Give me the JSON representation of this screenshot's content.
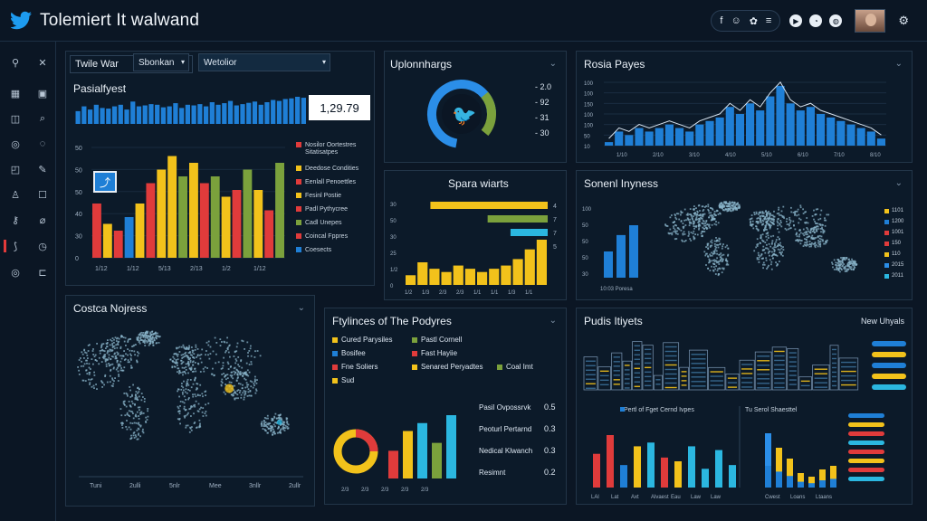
{
  "app": {
    "title": "Tolemiert   It walwand"
  },
  "header": {
    "social_icons": [
      "f",
      "☺",
      "✿",
      "≡"
    ],
    "action_icons": [
      "▶",
      "◔",
      "◍"
    ],
    "settings_icon": "⚙"
  },
  "sidebar": {
    "icons": [
      [
        "⚲",
        "✕"
      ],
      [
        "▦",
        "▣"
      ],
      [
        "◫",
        "⌕"
      ],
      [
        "◎",
        "◌"
      ],
      [
        "◰",
        "✎"
      ],
      [
        "♙",
        "☐"
      ],
      [
        "⚷",
        "⌀"
      ],
      [
        "⟆",
        "◷"
      ],
      [
        "◎",
        "⊏"
      ]
    ]
  },
  "panel1": {
    "tab_label": "Twile War",
    "select1": "Sbonkan",
    "select2": "Wetolior",
    "subtitle": "Pasialfyest",
    "big_number": "1,29.79",
    "chart_data": {
      "type": "bar",
      "x_ticks": [
        "1/12",
        "1/12",
        "5/13",
        "2/13",
        "1/2",
        "1/12"
      ],
      "y_ticks": [
        "50",
        "50",
        "50",
        "40",
        "30",
        "0"
      ],
      "legend": [
        "Nosilor Oortestres Sitatisatpes",
        "Deedose Condities",
        "Eenlall Penoettles",
        "Fesinl Postie",
        "Padl Pythycree",
        "Cadl Unepes",
        "Coincal Fppres",
        "Coesects"
      ],
      "values": [
        40,
        25,
        20,
        30,
        40,
        55,
        65,
        75,
        60,
        70,
        55,
        60,
        45,
        50,
        65,
        50,
        35,
        70
      ],
      "colors": [
        "#e03b3b",
        "#f2c21b",
        "#e03b3b",
        "#1f7fd6",
        "#f2c21b",
        "#e03b3b",
        "#f2c21b",
        "#f2c21b",
        "#7ba13c",
        "#f2c21b",
        "#e03b3b",
        "#7ba13c",
        "#f2c21b",
        "#e03b3b",
        "#7ba13c",
        "#f2c21b",
        "#e03b3b",
        "#7ba13c"
      ],
      "sparkline": [
        40,
        55,
        45,
        60,
        50,
        48,
        55,
        60,
        45,
        70,
        55,
        58,
        62,
        60,
        52,
        55,
        65,
        50,
        60,
        58,
        62,
        55,
        68,
        60,
        65,
        72,
        58,
        62,
        66,
        70,
        60,
        68,
        75,
        72,
        78,
        80,
        85,
        82
      ]
    }
  },
  "panel2": {
    "title": "Uplonnhargs",
    "labels": [
      "2.0",
      "92",
      "31",
      "30"
    ],
    "donut_colors": [
      "#2b8ee8",
      "#e0b21b",
      "#7ba13c"
    ]
  },
  "panel3": {
    "title": "Rosia Payes",
    "y_ticks": [
      "100",
      "100",
      "150",
      "100",
      "100",
      "50",
      "10"
    ],
    "x_ticks": [
      "1/10",
      "2/10",
      "3/10",
      "4/10",
      "5/10",
      "6/10",
      "7/10",
      "8/10"
    ],
    "values": [
      5,
      20,
      15,
      25,
      20,
      25,
      30,
      25,
      20,
      30,
      35,
      40,
      55,
      45,
      60,
      50,
      70,
      85,
      60,
      50,
      55,
      45,
      40,
      35,
      30,
      25,
      20,
      10
    ]
  },
  "panel4": {
    "title": "Spara wiarts",
    "y_ticks": [
      "30",
      "50",
      "30",
      "25",
      "1/2",
      "0"
    ],
    "x_ticks": [
      "1/2",
      "1/3",
      "2/3",
      "2/3",
      "1/1",
      "1/1",
      "1/3",
      "1/1"
    ],
    "bar_labels": [
      "4",
      "7",
      "7",
      "5"
    ],
    "hbars": [
      {
        "w": 0.82,
        "c": "#f2c21b"
      },
      {
        "w": 0.42,
        "c": "#7ba13c"
      },
      {
        "w": 0.26,
        "c": "#2bb7e0"
      }
    ],
    "values": [
      15,
      35,
      25,
      20,
      30,
      25,
      20,
      25,
      30,
      40,
      55,
      70
    ]
  },
  "panel5": {
    "title": "Sonenl Inyness",
    "footer": "10:03 Poresa",
    "y_ticks": [
      "100",
      "50",
      "50",
      "50",
      "30"
    ],
    "legend": [
      "1101",
      "1200",
      "1001",
      "150",
      "110",
      "2015",
      "2011"
    ],
    "legend_colors": [
      "#f2c21b",
      "#1f7fd6",
      "#e03b3b",
      "#e03b3b",
      "#f2c21b",
      "#2b8ee8",
      "#2bb7e0"
    ],
    "values": [
      40,
      65,
      80
    ]
  },
  "panel6": {
    "title": "Costca Nojress",
    "x_ticks": [
      "Tuni",
      "2ulli",
      "5nlr",
      "Mee",
      "3nllr",
      "2ullr"
    ]
  },
  "panel7": {
    "title": "Ftylinces of The Podyres",
    "legend": [
      {
        "label": "Cured Parysiles",
        "color": "#f2c21b"
      },
      {
        "label": "Pastl Cornell",
        "color": "#7ba13c"
      },
      {
        "label": "Bosifee",
        "color": "#1f7fd6"
      },
      {
        "label": "Fast Hayiie",
        "color": "#e03b3b"
      },
      {
        "label": "Fne Soliers",
        "color": "#e03b3b"
      },
      {
        "label": "Senared Peryadtes",
        "color": "#f2c21b"
      },
      {
        "label": "Coal Imt",
        "color": "#7ba13c"
      },
      {
        "label": "Sud",
        "color": "#f2c21b"
      }
    ],
    "stats": [
      {
        "label": "Pasil Ovpossrvk",
        "value": "0.5"
      },
      {
        "label": "Peoturl Pertarnd",
        "value": "0.3"
      },
      {
        "label": "Nedical Klwanch",
        "value": "0.3"
      },
      {
        "label": "Resimnt",
        "value": "0.2"
      }
    ],
    "x_ticks": [
      "2/3",
      "2/3",
      "2/3",
      "2/3",
      "2/3"
    ],
    "values": [
      35,
      60,
      70,
      45,
      80
    ],
    "colors": [
      "#e03b3b",
      "#f2c21b",
      "#2bb7e0",
      "#7ba13c",
      "#2bb7e0"
    ]
  },
  "panel8": {
    "title": "Pudis Itiyets",
    "right_label": "New Uhyals",
    "legend1": "Pertl of Fget Cernd Ivpes",
    "legend2": "Tu Serol Shaesttel",
    "x_ticks": [
      "LAl",
      "Lat",
      "Axt",
      "Alvaest",
      "Eau",
      "Law",
      "Law"
    ],
    "x_ticks2": [
      "Cwest",
      "Loans",
      "Ltaans"
    ],
    "values1": [
      45,
      70,
      30,
      55,
      60,
      40,
      35,
      55,
      25,
      50,
      30
    ],
    "colors1": [
      "#e03b3b",
      "#e03b3b",
      "#1f7fd6",
      "#f2c21b",
      "#2bb7e0",
      "#e03b3b",
      "#f2c21b",
      "#2bb7e0",
      "#2bb7e0",
      "#2bb7e0",
      "#2bb7e0"
    ],
    "values2": [
      75,
      55,
      40,
      20,
      15,
      25,
      30
    ],
    "bars_right": [
      "#1f7fd6",
      "#f2c21b",
      "#e03b3b",
      "#2bb7e0",
      "#e03b3b",
      "#f2c21b",
      "#e03b3b",
      "#2bb7e0"
    ],
    "bars_right2": [
      "#e03b3b",
      "#e03b3b",
      "#f2c21b",
      "#e03b3b",
      "#f2c21b",
      "#2bb7e0"
    ]
  }
}
